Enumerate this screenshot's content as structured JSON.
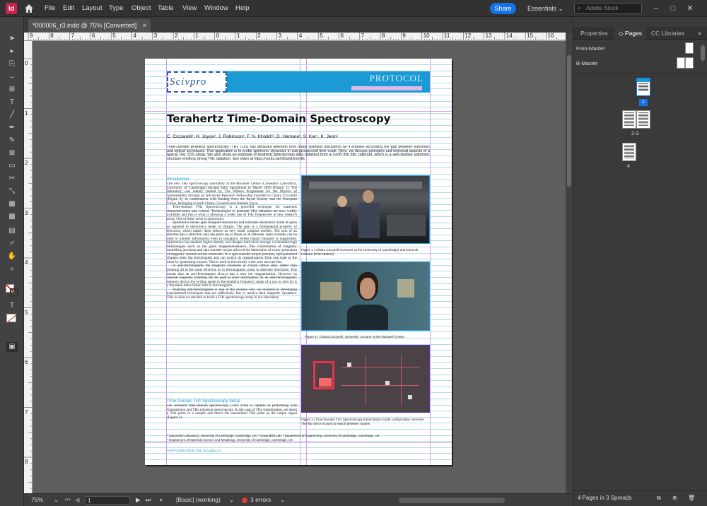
{
  "menubar": {
    "app_logo": "Id",
    "home_icon": "home-icon",
    "items": [
      "File",
      "Edit",
      "Layout",
      "Type",
      "Object",
      "Table",
      "View",
      "Window",
      "Help"
    ],
    "share_label": "Share",
    "workspace_label": "Essentials",
    "search_placeholder": "Adobe Stock"
  },
  "tab": {
    "title": "*000006_r3.indd @ 75% [Converted]",
    "close_label": "×"
  },
  "rulers": {
    "horizontal": [
      "9",
      "8",
      "7",
      "6",
      "5",
      "4",
      "3",
      "2",
      "1",
      "0",
      "1",
      "2",
      "3",
      "4",
      "5",
      "6",
      "7",
      "8",
      "9",
      "10",
      "11",
      "12",
      "13",
      "14",
      "15",
      "16",
      "17"
    ],
    "vertical": [
      "0",
      "1",
      "2",
      "3",
      "4",
      "5",
      "6",
      "7",
      "8"
    ]
  },
  "document": {
    "header_logo": "Scivpro",
    "header_label": "PROTOCOL",
    "title": "Terahertz Time-Domain Spectroscopy",
    "authors": "C. Ciccarelli¹, H. Joyce², J. Robinson³, F. N. Kholid¹², D. Hamara¹, S. Kar⁴, K. Jeon¹",
    "abstract": "Time-Domain terahertz spectroscopy (THz TDS) has attracted attention from many scientific disciplines as it enables accessing the gap between electronic and optical techniques. One application is to probe spintronic dynamics in sub-picosecond time scale. Here, we discuss principles and technical aspects of a typical THz TDS setup. We also show an example of terahertz time-domain data obtained from a Co/Pt thin film calibrant, which is a well-studied spintronic structure emitting strong THz radiation. See video at https://youtu.be/XZwwQnmy8c",
    "intro_heading": "Introduction",
    "intro_p1": "The new THz spectroscopy laboratory at the Maxwell Centre (Cavendish Laboratory, University of Cambridge) became fully operational in March 2019 (Figure 1). The laboratory was mainly funded by The Winton Programme for the Physics of Sustainability through an Advanced Research Fellowship awarded to Chiara Ciccarelli (Figure 2), in combination with funding from the Royal Society and the European Union, belonging to both Chiara Ciccarelli and Hannah Joyce.",
    "intro_p2": "Time-domain THz Spectroscopy is a powerful technique for materials characterization and control. Technologies to generate THz radiation are now widely available and this is what is allowing a wider use of THz frequencies in new research areas. One of these areas is spintronics.",
    "intro_p3": "Spintronics means spin transport electronics and indicates electronics made of spins as opposed to electronics made of charges. The spin is a fundamental property of electrons, which makes them behave as very small compass needles. The spin of an electron has a direction and can point up or down or in between. Spin currents can be used to transfer information even in insulators, where charge transport is suppressed. Spintronics has enabled higher-density and cheaper hard-drive storage via breakthrough technologies such as the giant magnetoresistance. The combination of magnetic tunnelling junctions and spin-transfer-torque allowed the fabrication of a new generation of magnetic random-access memories. In a spin-transfer-torque junction, spin-polarised charges enter the ferromagnet and can switch its magnetisation from one state to the other by generating torques. This is used to electrically write zero and one bits.",
    "intro_p4": "In anti-ferromagnets the magnetic moments at crystal lattice sites, rather than pointing all in the same direction as in ferromagnets, point in alternate directions. This means that an anti-ferromagnet always has a zero net magnetisation. However its internal magnetic ordering can be used to store information. In an anti-ferromagnetic memory device the writing speed in the terahertz frequency range of a one or zero bit is a thousand times faster than in ferromagnets.",
    "intro_p5": "Studying anti-ferromagnets is one of the reasons why we invested in developing experimental techniques that are sufficiently fast to resolve their magnetic dynamics. This is what we decided to build a THz spectroscopy setup in our laboratory.",
    "setup_heading": "Time-Domain THz Spectroscopy Setup",
    "setup_p1": "Our terahertz time-domain spectroscopy (THz TDS) is capable of performing THz transmission and THz emission spectroscopy. In the case of THz transmission, we shoot a THz pulse to a sample and detect the transmitted THz pulse as the output signal (Figure 3).",
    "fig1_caption": "Figure 1 | Chiara Ciccarelli (Lecturer at the University of Cambridge) and Dominik Hamara (PhD student).",
    "fig2_caption": "Figure 2 | Chiara Ciccarelli, University Lecturer at the Maxwell Centre.",
    "fig3_caption": "Figure 3 | Time-Domain THz Spectroscopy transmission mode configuration overview. The flip mirror is used to switch between modes.",
    "footnote1": "¹ Cavendish Laboratory, University of Cambridge, Cambridge, UK, ² Cavendish Lab, ³ Department of Engineering, University of Cambridge, Cambridge, UK",
    "footnote2": "⁴ Department of Materials Science and Metallurgy, University of Cambridge, Cambridge, UK",
    "doi_line": "ScivPro 0000 Month Year, doi.org/xx.xx"
  },
  "status": {
    "zoom": "75%",
    "page": "1",
    "style": "[Basic] (working)",
    "errors": "3 errors"
  },
  "panel": {
    "tabs": [
      "Properties",
      "Pages",
      "CC Libraries"
    ],
    "masters": [
      "Fron-Master",
      "B-Master"
    ],
    "page_labels": [
      "1",
      "2-3",
      "4"
    ],
    "footer": "4 Pages in 3 Spreads"
  },
  "colors": {
    "accent": "#1473e6",
    "protocol_banner": "#1b9ad6",
    "guide_blue": "#b5d9e8",
    "margin_purple": "#cf9fe6",
    "heading_teal": "#1b9ad6",
    "error_red": "#e03c3c"
  }
}
